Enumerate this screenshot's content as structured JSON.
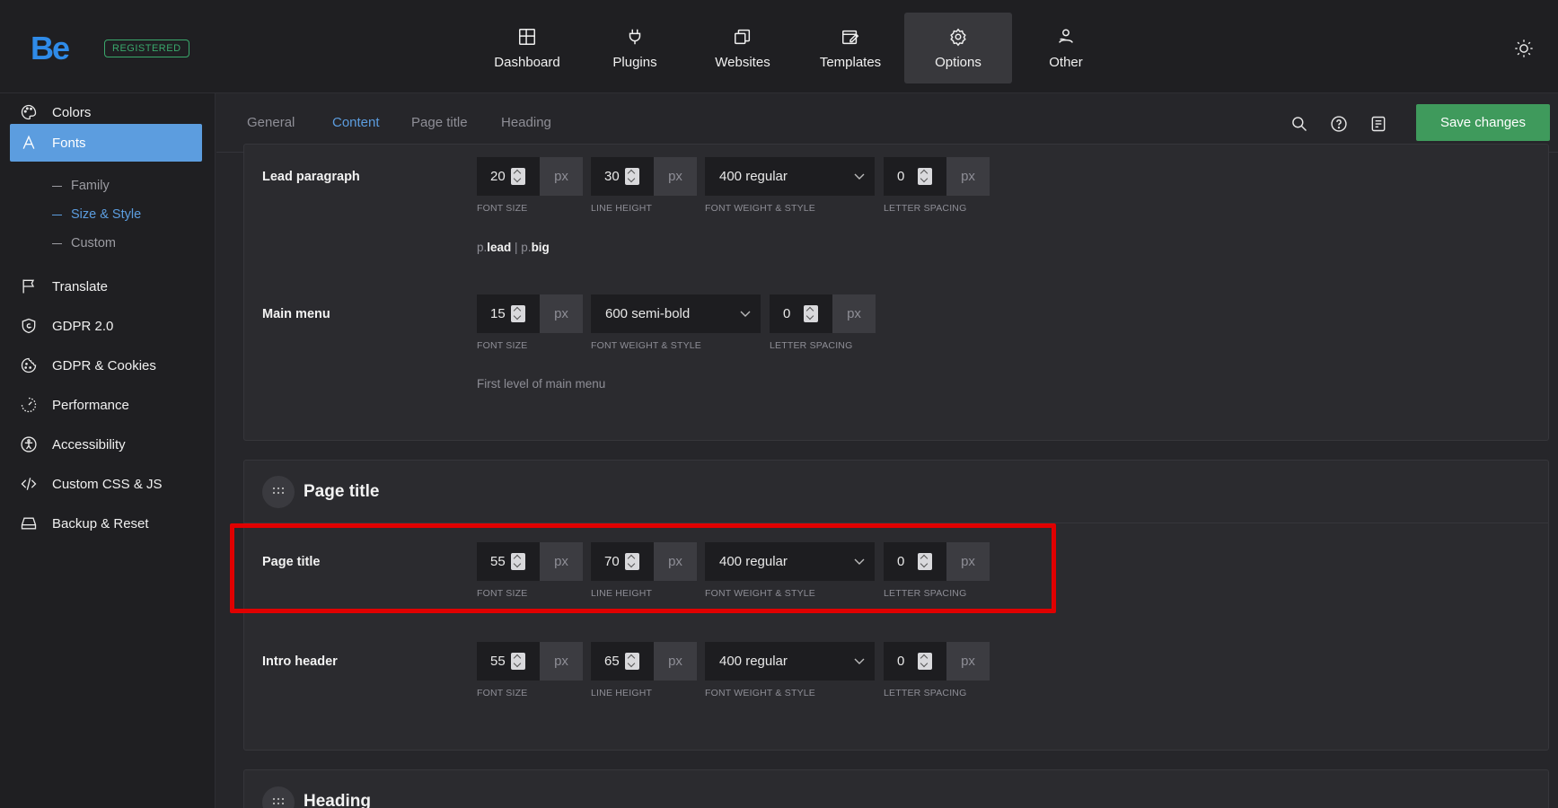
{
  "app": {
    "logo": "Be",
    "badge": "REGISTERED"
  },
  "topnav": [
    {
      "label": "Dashboard",
      "icon": "dashboard-icon"
    },
    {
      "label": "Plugins",
      "icon": "plug-icon"
    },
    {
      "label": "Websites",
      "icon": "websites-icon"
    },
    {
      "label": "Templates",
      "icon": "templates-icon"
    },
    {
      "label": "Options",
      "icon": "gear-icon",
      "active": true
    },
    {
      "label": "Other",
      "icon": "other-icon"
    }
  ],
  "sidebar": {
    "items": [
      {
        "label": "Colors",
        "icon": "palette-icon"
      },
      {
        "label": "Fonts",
        "icon": "font-icon",
        "active": true
      },
      {
        "label": "Translate",
        "icon": "flag-icon"
      },
      {
        "label": "GDPR 2.0",
        "icon": "shield-icon"
      },
      {
        "label": "GDPR & Cookies",
        "icon": "cookie-icon"
      },
      {
        "label": "Performance",
        "icon": "gauge-icon"
      },
      {
        "label": "Accessibility",
        "icon": "accessibility-icon"
      },
      {
        "label": "Custom CSS & JS",
        "icon": "code-icon"
      },
      {
        "label": "Backup & Reset",
        "icon": "drive-icon"
      }
    ],
    "fonts_sub": [
      {
        "label": "Family"
      },
      {
        "label": "Size & Style",
        "active": true
      },
      {
        "label": "Custom"
      }
    ]
  },
  "tabs": [
    {
      "label": "General"
    },
    {
      "label": "Content",
      "active": true
    },
    {
      "label": "Page title"
    },
    {
      "label": "Heading"
    }
  ],
  "header": {
    "save_label": "Save changes"
  },
  "labels": {
    "font_size": "FONT SIZE",
    "line_height": "LINE HEIGHT",
    "font_weight": "FONT WEIGHT & STYLE",
    "letter_spacing": "LETTER SPACING",
    "unit": "px"
  },
  "content": {
    "lead_paragraph": {
      "label": "Lead paragraph",
      "font_size": "20",
      "line_height": "30",
      "weight": "400 regular",
      "letter_spacing": "0",
      "note_p1": "p.",
      "note_b1": "lead",
      "note_sep": " | ",
      "note_p2": "p.",
      "note_b2": "big"
    },
    "main_menu": {
      "label": "Main menu",
      "font_size": "15",
      "weight": "600 semi-bold",
      "letter_spacing": "0",
      "note": "First level of main menu"
    },
    "page_title_section": {
      "title": "Page title"
    },
    "page_title": {
      "label": "Page title",
      "font_size": "55",
      "line_height": "70",
      "weight": "400 regular",
      "letter_spacing": "0"
    },
    "intro_header": {
      "label": "Intro header",
      "font_size": "55",
      "line_height": "65",
      "weight": "400 regular",
      "letter_spacing": "0"
    },
    "heading_section": {
      "title": "Heading"
    }
  },
  "colors": {
    "accent": "#5c9ddf",
    "save": "#3f9a5c",
    "highlight": "#e00000"
  }
}
